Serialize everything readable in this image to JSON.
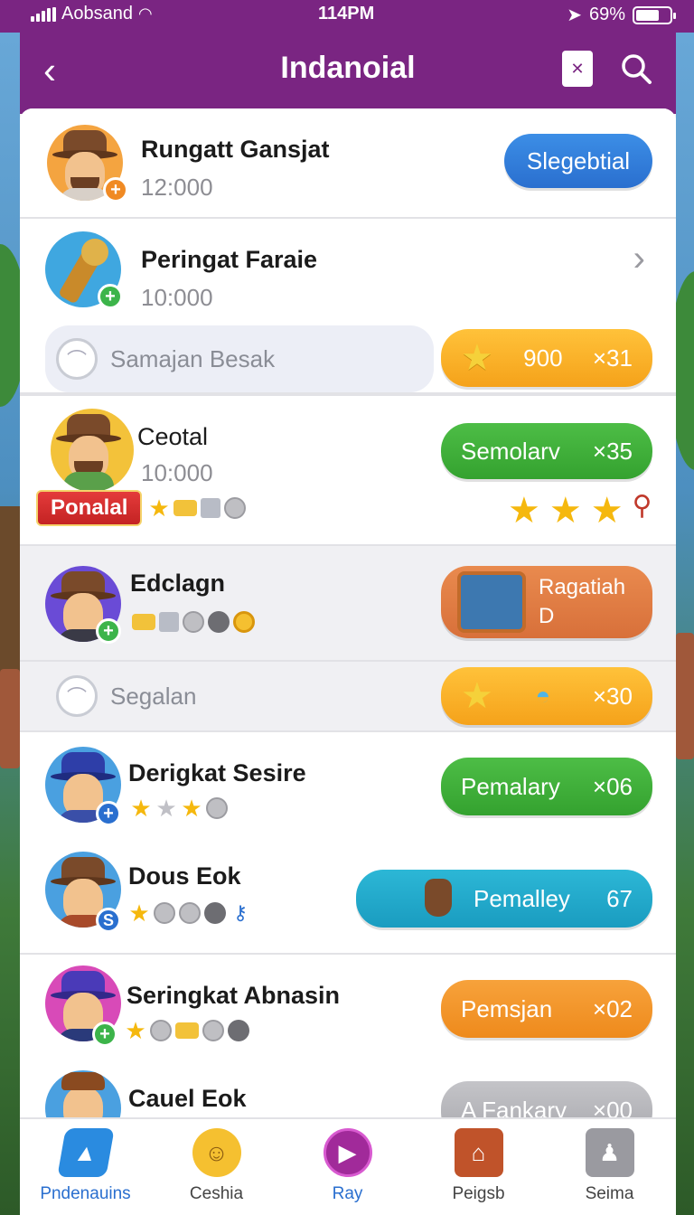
{
  "status_bar": {
    "carrier": "Aobsand",
    "time": "114PM",
    "battery": "69%"
  },
  "header": {
    "title": "Indanoial",
    "back_icon": "chevron-left-icon",
    "doc_icon": "document-icon",
    "search_icon": "search-icon"
  },
  "rows": [
    {
      "name": "Rungatt Gansjat",
      "amount": "12:000",
      "button": "Slegebtial"
    },
    {
      "name": "Peringat Faraie",
      "amount": "10:000"
    },
    {
      "search_placeholder": "Samajan Besak",
      "pill_value": "900",
      "pill_mult": "×31"
    },
    {
      "name": "Ceotal",
      "amount": "10:000",
      "banner": "Ponalal",
      "button": "Semolarv",
      "mult": "×35"
    },
    {
      "name": "Edclagn",
      "button_line1": "Ragatiah",
      "button_line2": "D"
    },
    {
      "search_placeholder": "Segalan",
      "pill_mult": "×30"
    },
    {
      "name": "Derigkat Sesire",
      "button": "Pemalary",
      "mult": "×06"
    },
    {
      "name": "Dous Eok",
      "button": "Pemalley",
      "mult": "67",
      "badge": "S"
    },
    {
      "name": "Seringkat Abnasin",
      "button": "Pemsjan",
      "mult": "×02"
    },
    {
      "name": "Cauel Eok",
      "button": "A Fankary",
      "mult": "×00"
    }
  ],
  "tabs": [
    {
      "label": "Pndenauins",
      "icon": "pyramid-icon"
    },
    {
      "label": "Ceshia",
      "icon": "smiley-icon"
    },
    {
      "label": "Ray",
      "icon": "play-icon"
    },
    {
      "label": "Peigsb",
      "icon": "shop-icon"
    },
    {
      "label": "Seima",
      "icon": "profile-icon"
    }
  ],
  "colors": {
    "header": "#7a2582",
    "accent_blue": "#2a6fcf",
    "green": "#34a22f",
    "orange": "#f5a21a"
  }
}
